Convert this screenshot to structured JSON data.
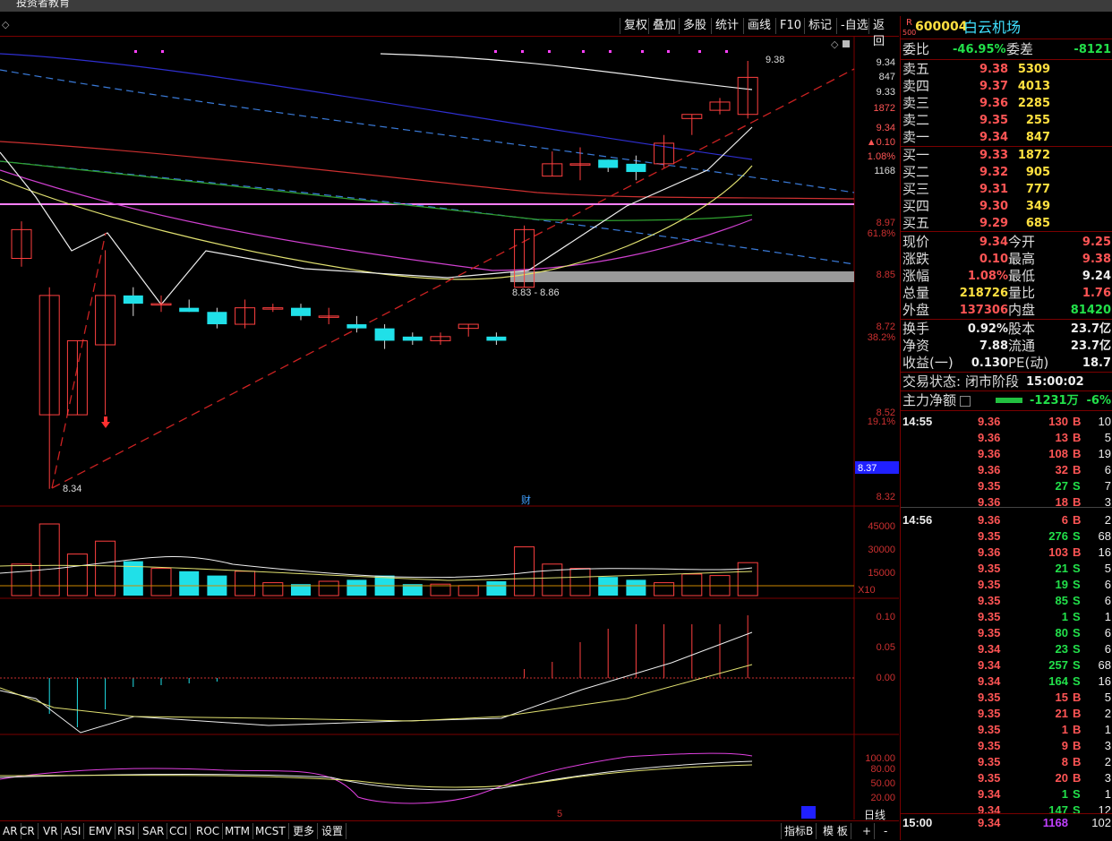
{
  "window": {
    "title": "投资者教育"
  },
  "toolbar": {
    "items": [
      "复权",
      "叠加",
      "多股",
      "统计",
      "画线",
      "F10",
      "标记",
      "-自选",
      "返回"
    ]
  },
  "chart_data": {
    "type": "candlestick",
    "annotations": {
      "high_label": "9.38",
      "low_label": "8.34",
      "zone_label": "8.83 - 8.86",
      "marker_cai": "财",
      "x_tick": "5"
    },
    "price_axis": {
      "ticks": [
        "9.34",
        "847",
        "9.33",
        "1872",
        "9.34",
        "▲0.10",
        "1.08%",
        "1168",
        "8.97",
        "61.8%",
        "8.85",
        "8.72",
        "38.2%",
        "8.52",
        "19.1%",
        "8.37",
        "8.32"
      ]
    },
    "volume_axis": {
      "ticks": [
        "45000",
        "30000",
        "15000"
      ],
      "unit": "X10"
    },
    "macd_axis": {
      "ticks": [
        "0.10",
        "0.05",
        "0.00"
      ]
    },
    "kdj_axis": {
      "ticks": [
        "100.00",
        "80.00",
        "50.00",
        "20.00"
      ]
    },
    "candles": [
      {
        "o": 8.9,
        "c": 8.97,
        "h": 8.99,
        "l": 8.88
      },
      {
        "o": 8.52,
        "c": 8.81,
        "h": 8.83,
        "l": 8.34
      },
      {
        "o": 8.52,
        "c": 8.7,
        "h": 8.7,
        "l": 8.52
      },
      {
        "o": 8.69,
        "c": 8.81,
        "h": 8.92,
        "l": 8.52
      },
      {
        "o": 8.81,
        "c": 8.79,
        "h": 8.83,
        "l": 8.76
      },
      {
        "o": 8.79,
        "c": 8.79,
        "h": 8.81,
        "l": 8.77
      },
      {
        "o": 8.78,
        "c": 8.77,
        "h": 8.8,
        "l": 8.77
      },
      {
        "o": 8.77,
        "c": 8.74,
        "h": 8.78,
        "l": 8.73
      },
      {
        "o": 8.74,
        "c": 8.78,
        "h": 8.8,
        "l": 8.73
      },
      {
        "o": 8.78,
        "c": 8.78,
        "h": 8.79,
        "l": 8.77
      },
      {
        "o": 8.78,
        "c": 8.76,
        "h": 8.79,
        "l": 8.75
      },
      {
        "o": 8.76,
        "c": 8.76,
        "h": 8.78,
        "l": 8.74
      },
      {
        "o": 8.74,
        "c": 8.73,
        "h": 8.76,
        "l": 8.72
      },
      {
        "o": 8.73,
        "c": 8.7,
        "h": 8.74,
        "l": 8.68
      },
      {
        "o": 8.71,
        "c": 8.7,
        "h": 8.72,
        "l": 8.69
      },
      {
        "o": 8.7,
        "c": 8.71,
        "h": 8.72,
        "l": 8.69
      },
      {
        "o": 8.73,
        "c": 8.74,
        "h": 8.74,
        "l": 8.71
      },
      {
        "o": 8.71,
        "c": 8.7,
        "h": 8.72,
        "l": 8.69
      },
      {
        "o": 8.83,
        "c": 8.97,
        "h": 8.98,
        "l": 8.83
      },
      {
        "o": 9.1,
        "c": 9.13,
        "h": 9.16,
        "l": 9.1
      },
      {
        "o": 9.13,
        "c": 9.13,
        "h": 9.17,
        "l": 9.09
      },
      {
        "o": 9.14,
        "c": 9.12,
        "h": 9.14,
        "l": 9.11
      },
      {
        "o": 9.13,
        "c": 9.11,
        "h": 9.15,
        "l": 9.09
      },
      {
        "o": 9.13,
        "c": 9.18,
        "h": 9.2,
        "l": 9.12
      },
      {
        "o": 9.24,
        "c": 9.25,
        "h": 9.25,
        "l": 9.2
      },
      {
        "o": 9.26,
        "c": 9.28,
        "h": 9.29,
        "l": 9.25
      },
      {
        "o": 9.25,
        "c": 9.34,
        "h": 9.38,
        "l": 9.24
      }
    ],
    "volumes": [
      22000,
      50000,
      29000,
      38000,
      24000,
      19000,
      17000,
      14000,
      17000,
      9000,
      8000,
      10000,
      11000,
      14000,
      8000,
      8000,
      7000,
      10000,
      34000,
      22000,
      19000,
      13000,
      11000,
      9000,
      15000,
      14000,
      23000
    ]
  },
  "quote": {
    "badge_r": "R",
    "badge_num": "500",
    "code": "600004",
    "name": "白云机场",
    "weibi_label": "委比",
    "weibi": "-46.95%",
    "weicha_label": "委差",
    "weicha": "-8121",
    "asks": [
      {
        "label": "卖五",
        "price": "9.38",
        "vol": "5309"
      },
      {
        "label": "卖四",
        "price": "9.37",
        "vol": "4013"
      },
      {
        "label": "卖三",
        "price": "9.36",
        "vol": "2285"
      },
      {
        "label": "卖二",
        "price": "9.35",
        "vol": "255"
      },
      {
        "label": "卖一",
        "price": "9.34",
        "vol": "847"
      }
    ],
    "bids": [
      {
        "label": "买一",
        "price": "9.33",
        "vol": "1872"
      },
      {
        "label": "买二",
        "price": "9.32",
        "vol": "905"
      },
      {
        "label": "买三",
        "price": "9.31",
        "vol": "777"
      },
      {
        "label": "买四",
        "price": "9.30",
        "vol": "349"
      },
      {
        "label": "买五",
        "price": "9.29",
        "vol": "685"
      }
    ],
    "stats": [
      {
        "l1": "现价",
        "v1": "9.34",
        "c1": "red",
        "l2": "今开",
        "v2": "9.25",
        "c2": "red"
      },
      {
        "l1": "涨跌",
        "v1": "0.10",
        "c1": "red",
        "l2": "最高",
        "v2": "9.38",
        "c2": "red"
      },
      {
        "l1": "涨幅",
        "v1": "1.08%",
        "c1": "red",
        "l2": "最低",
        "v2": "9.24",
        "c2": "white"
      },
      {
        "l1": "总量",
        "v1": "218726",
        "c1": "yellow",
        "l2": "量比",
        "v2": "1.76",
        "c2": "red"
      },
      {
        "l1": "外盘",
        "v1": "137306",
        "c1": "red",
        "l2": "内盘",
        "v2": "81420",
        "c2": "green"
      }
    ],
    "stats2": [
      {
        "l1": "换手",
        "v1": "0.92%",
        "l2": "股本",
        "v2": "23.7亿"
      },
      {
        "l1": "净资",
        "v1": "7.88",
        "l2": "流通",
        "v2": "23.7亿"
      },
      {
        "l1": "收益(一)",
        "v1": "0.130",
        "l2": "PE(动)",
        "v2": "18.7"
      }
    ],
    "trade_state_label": "交易状态:",
    "trade_state": "闭市阶段",
    "trade_time": "15:00:02",
    "main_flow_label": "主力净额",
    "main_flow": "-1231万",
    "main_flow_pct": "-6%"
  },
  "ticks": [
    {
      "t": "14:55",
      "p": "9.36",
      "v": "130",
      "s": "B",
      "n": "10"
    },
    {
      "t": "",
      "p": "9.36",
      "v": "13",
      "s": "B",
      "n": "5"
    },
    {
      "t": "",
      "p": "9.36",
      "v": "108",
      "s": "B",
      "n": "19"
    },
    {
      "t": "",
      "p": "9.36",
      "v": "32",
      "s": "B",
      "n": "6"
    },
    {
      "t": "",
      "p": "9.35",
      "v": "27",
      "s": "S",
      "n": "7"
    },
    {
      "t": "",
      "p": "9.36",
      "v": "18",
      "s": "B",
      "n": "3"
    },
    {
      "t": "14:56",
      "p": "9.36",
      "v": "6",
      "s": "B",
      "n": "2"
    },
    {
      "t": "",
      "p": "9.35",
      "v": "276",
      "s": "S",
      "n": "68"
    },
    {
      "t": "",
      "p": "9.36",
      "v": "103",
      "s": "B",
      "n": "16"
    },
    {
      "t": "",
      "p": "9.35",
      "v": "21",
      "s": "S",
      "n": "5"
    },
    {
      "t": "",
      "p": "9.35",
      "v": "19",
      "s": "S",
      "n": "6"
    },
    {
      "t": "",
      "p": "9.35",
      "v": "85",
      "s": "S",
      "n": "6"
    },
    {
      "t": "",
      "p": "9.35",
      "v": "1",
      "s": "S",
      "n": "1"
    },
    {
      "t": "",
      "p": "9.35",
      "v": "80",
      "s": "S",
      "n": "6"
    },
    {
      "t": "",
      "p": "9.34",
      "v": "23",
      "s": "S",
      "n": "6"
    },
    {
      "t": "",
      "p": "9.34",
      "v": "257",
      "s": "S",
      "n": "68"
    },
    {
      "t": "",
      "p": "9.34",
      "v": "164",
      "s": "S",
      "n": "16"
    },
    {
      "t": "",
      "p": "9.35",
      "v": "15",
      "s": "B",
      "n": "5"
    },
    {
      "t": "",
      "p": "9.35",
      "v": "21",
      "s": "B",
      "n": "2"
    },
    {
      "t": "",
      "p": "9.35",
      "v": "1",
      "s": "B",
      "n": "1"
    },
    {
      "t": "",
      "p": "9.35",
      "v": "9",
      "s": "B",
      "n": "3"
    },
    {
      "t": "",
      "p": "9.35",
      "v": "8",
      "s": "B",
      "n": "2"
    },
    {
      "t": "",
      "p": "9.35",
      "v": "20",
      "s": "B",
      "n": "3"
    },
    {
      "t": "",
      "p": "9.34",
      "v": "1",
      "s": "S",
      "n": "1"
    },
    {
      "t": "",
      "p": "9.34",
      "v": "147",
      "s": "S",
      "n": "12"
    },
    {
      "t": "15:00",
      "p": "9.34",
      "v": "1168",
      "s": "",
      "n": "102"
    }
  ],
  "indicators": [
    "AR",
    "CR",
    "VR",
    "ASI",
    "EMV",
    "RSI",
    "SAR",
    "CCI",
    "ROC",
    "MTM",
    "MCST",
    "更多",
    "设置"
  ],
  "bottom_right": {
    "period": "日线",
    "indicator_b": "指标B",
    "template": "模 板",
    "plus": "+",
    "minus": "-"
  }
}
